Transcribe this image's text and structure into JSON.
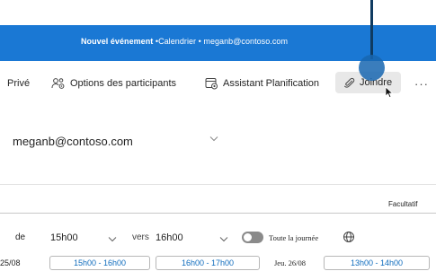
{
  "window": {
    "title_bold": "Nouvel événement",
    "title_rest": " •Calendrier • meganb@contoso.com"
  },
  "toolbar": {
    "private_label": "Privé",
    "participants_label": "Options des participants",
    "assistant_label": "Assistant Planification",
    "attach_label": "Joindre",
    "more_label": "···"
  },
  "account": {
    "email": "meganb@contoso.com"
  },
  "attendees": {
    "optional_label": "Facultatif"
  },
  "time": {
    "from_label": "de",
    "start_value": "15h00",
    "to_label": "vers",
    "end_value": "16h00",
    "all_day_label": "Toute la journée",
    "all_day_on": false
  },
  "suggestions": {
    "date_1": "25/08",
    "slots_1": [
      "15h00 - 16h00",
      "16h00 - 17h00"
    ],
    "date_2": "Jeu. 26/08",
    "slots_2": [
      "13h00 - 14h00"
    ]
  },
  "colors": {
    "titlebar": "#1a78d4",
    "accent": "#0f6cbd",
    "callout": "#1766b0"
  },
  "icons": {
    "participants": "people-settings-icon",
    "assistant": "calendar-assistant-icon",
    "attach": "paperclip-icon",
    "time_zone": "globe-icon"
  }
}
